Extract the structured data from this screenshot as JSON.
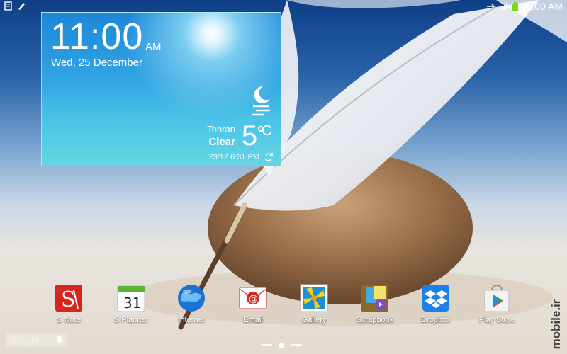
{
  "status_bar": {
    "time": "11:00 AM",
    "left_icons": [
      "notes-icon",
      "pen-icon"
    ],
    "right_icons": [
      "sync-icon",
      "signal-icon",
      "battery-icon"
    ],
    "battery_color": "#7ed321"
  },
  "weather_widget": {
    "time": "11:00",
    "ampm": "AM",
    "date": "Wed, 25 December",
    "city": "Tehran",
    "condition": "Clear",
    "temperature": "5",
    "unit": "C",
    "updated": "23/12 6:31 PM",
    "condition_icon": "moon-icon"
  },
  "apps": [
    {
      "label": "S Note",
      "icon": "s-note-icon",
      "color": "#d8261e"
    },
    {
      "label": "S Planner",
      "icon": "calendar-icon",
      "day": "31",
      "color": "#5bb52f"
    },
    {
      "label": "Internet",
      "icon": "globe-icon",
      "color": "#1b73d4"
    },
    {
      "label": "Email",
      "icon": "email-icon",
      "color": "#d8261e"
    },
    {
      "label": "Gallery",
      "icon": "gallery-icon",
      "color": "#f5d311"
    },
    {
      "label": "Scrapbook",
      "icon": "scrapbook-icon",
      "color": "#8a6a2a"
    },
    {
      "label": "Dropbox",
      "icon": "dropbox-icon",
      "color": "#1b81e6"
    },
    {
      "label": "Play Store",
      "icon": "play-store-icon",
      "color": "#e9e9e9"
    }
  ],
  "google_bar": {
    "text": "Google"
  },
  "page_indicator": {
    "pages": 3,
    "current": 2
  },
  "watermark": "mobile.ir"
}
